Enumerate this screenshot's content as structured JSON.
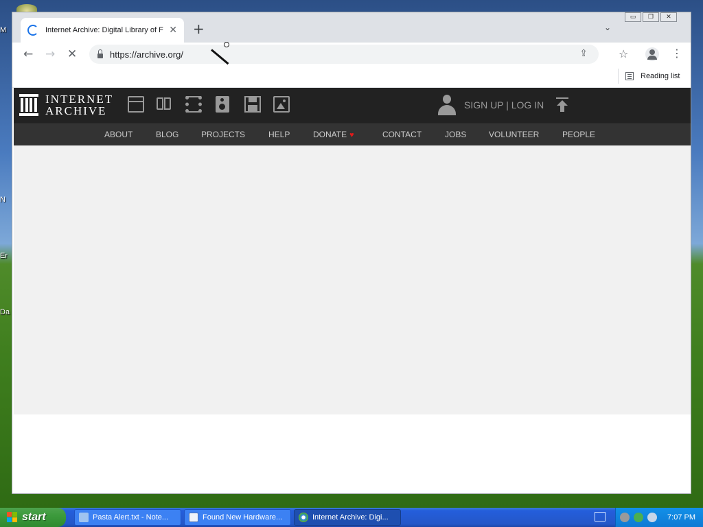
{
  "desktop": {
    "labels": [
      "M",
      "N",
      "Er",
      "Da"
    ]
  },
  "window": {
    "controls": {
      "minimize": "▭",
      "restore": "❐",
      "close": "✕"
    }
  },
  "browser": {
    "tab": {
      "title": "Internet Archive: Digital Library of F",
      "close": "✕"
    },
    "new_tab": "+",
    "tab_search": "⌄",
    "back": "←",
    "forward": "→",
    "reload": "✕",
    "url": "https://archive.org/",
    "share": "⇪",
    "bookmark_star": "☆",
    "menu": "⋮",
    "reading_list": "Reading list"
  },
  "site": {
    "logo_line1": "INTERNET",
    "logo_line2": "ARCHIVE",
    "media_icons": [
      "web-icon",
      "texts-icon",
      "video-icon",
      "audio-icon",
      "software-icon",
      "images-icon"
    ],
    "auth_link": "SIGN UP | LOG IN",
    "nav": [
      {
        "label": "ABOUT"
      },
      {
        "label": "BLOG"
      },
      {
        "label": "PROJECTS"
      },
      {
        "label": "HELP"
      },
      {
        "label": "DONATE"
      },
      {
        "label": "CONTACT"
      },
      {
        "label": "JOBS"
      },
      {
        "label": "VOLUNTEER"
      },
      {
        "label": "PEOPLE"
      }
    ],
    "donate_heart": "♥",
    "colors": {
      "topbar": "#222222",
      "navbar": "#333333",
      "icon_gray": "#999999",
      "heart": "#e01b1b"
    }
  },
  "taskbar": {
    "start": "start",
    "tasks": [
      {
        "label": "Pasta Alert.txt - Note..."
      },
      {
        "label": "Found New Hardware..."
      },
      {
        "label": "Internet Archive: Digi..."
      }
    ],
    "clock": "7:07 PM"
  }
}
